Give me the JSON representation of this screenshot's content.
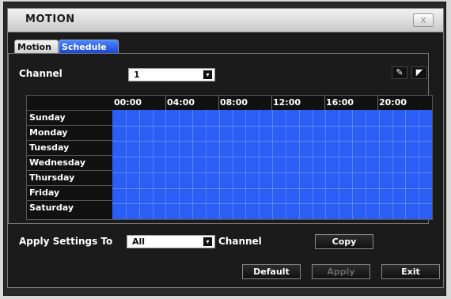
{
  "window": {
    "title": "MOTION",
    "close_label": "X"
  },
  "tabs": [
    {
      "label": "Motion",
      "active": false
    },
    {
      "label": "Schedule",
      "active": true
    }
  ],
  "channel": {
    "label": "Channel",
    "value": "1"
  },
  "schedule": {
    "hours": [
      "00:00",
      "04:00",
      "08:00",
      "12:00",
      "16:00",
      "20:00"
    ],
    "days": [
      "Sunday",
      "Monday",
      "Tuesday",
      "Wednesday",
      "Thursday",
      "Friday",
      "Saturday"
    ],
    "fill_color": "#2a5ef5"
  },
  "apply_settings": {
    "label": "Apply Settings To",
    "value": "All",
    "suffix": "Channel",
    "copy_label": "Copy"
  },
  "footer": {
    "default_label": "Default",
    "apply_label": "Apply",
    "exit_label": "Exit"
  }
}
